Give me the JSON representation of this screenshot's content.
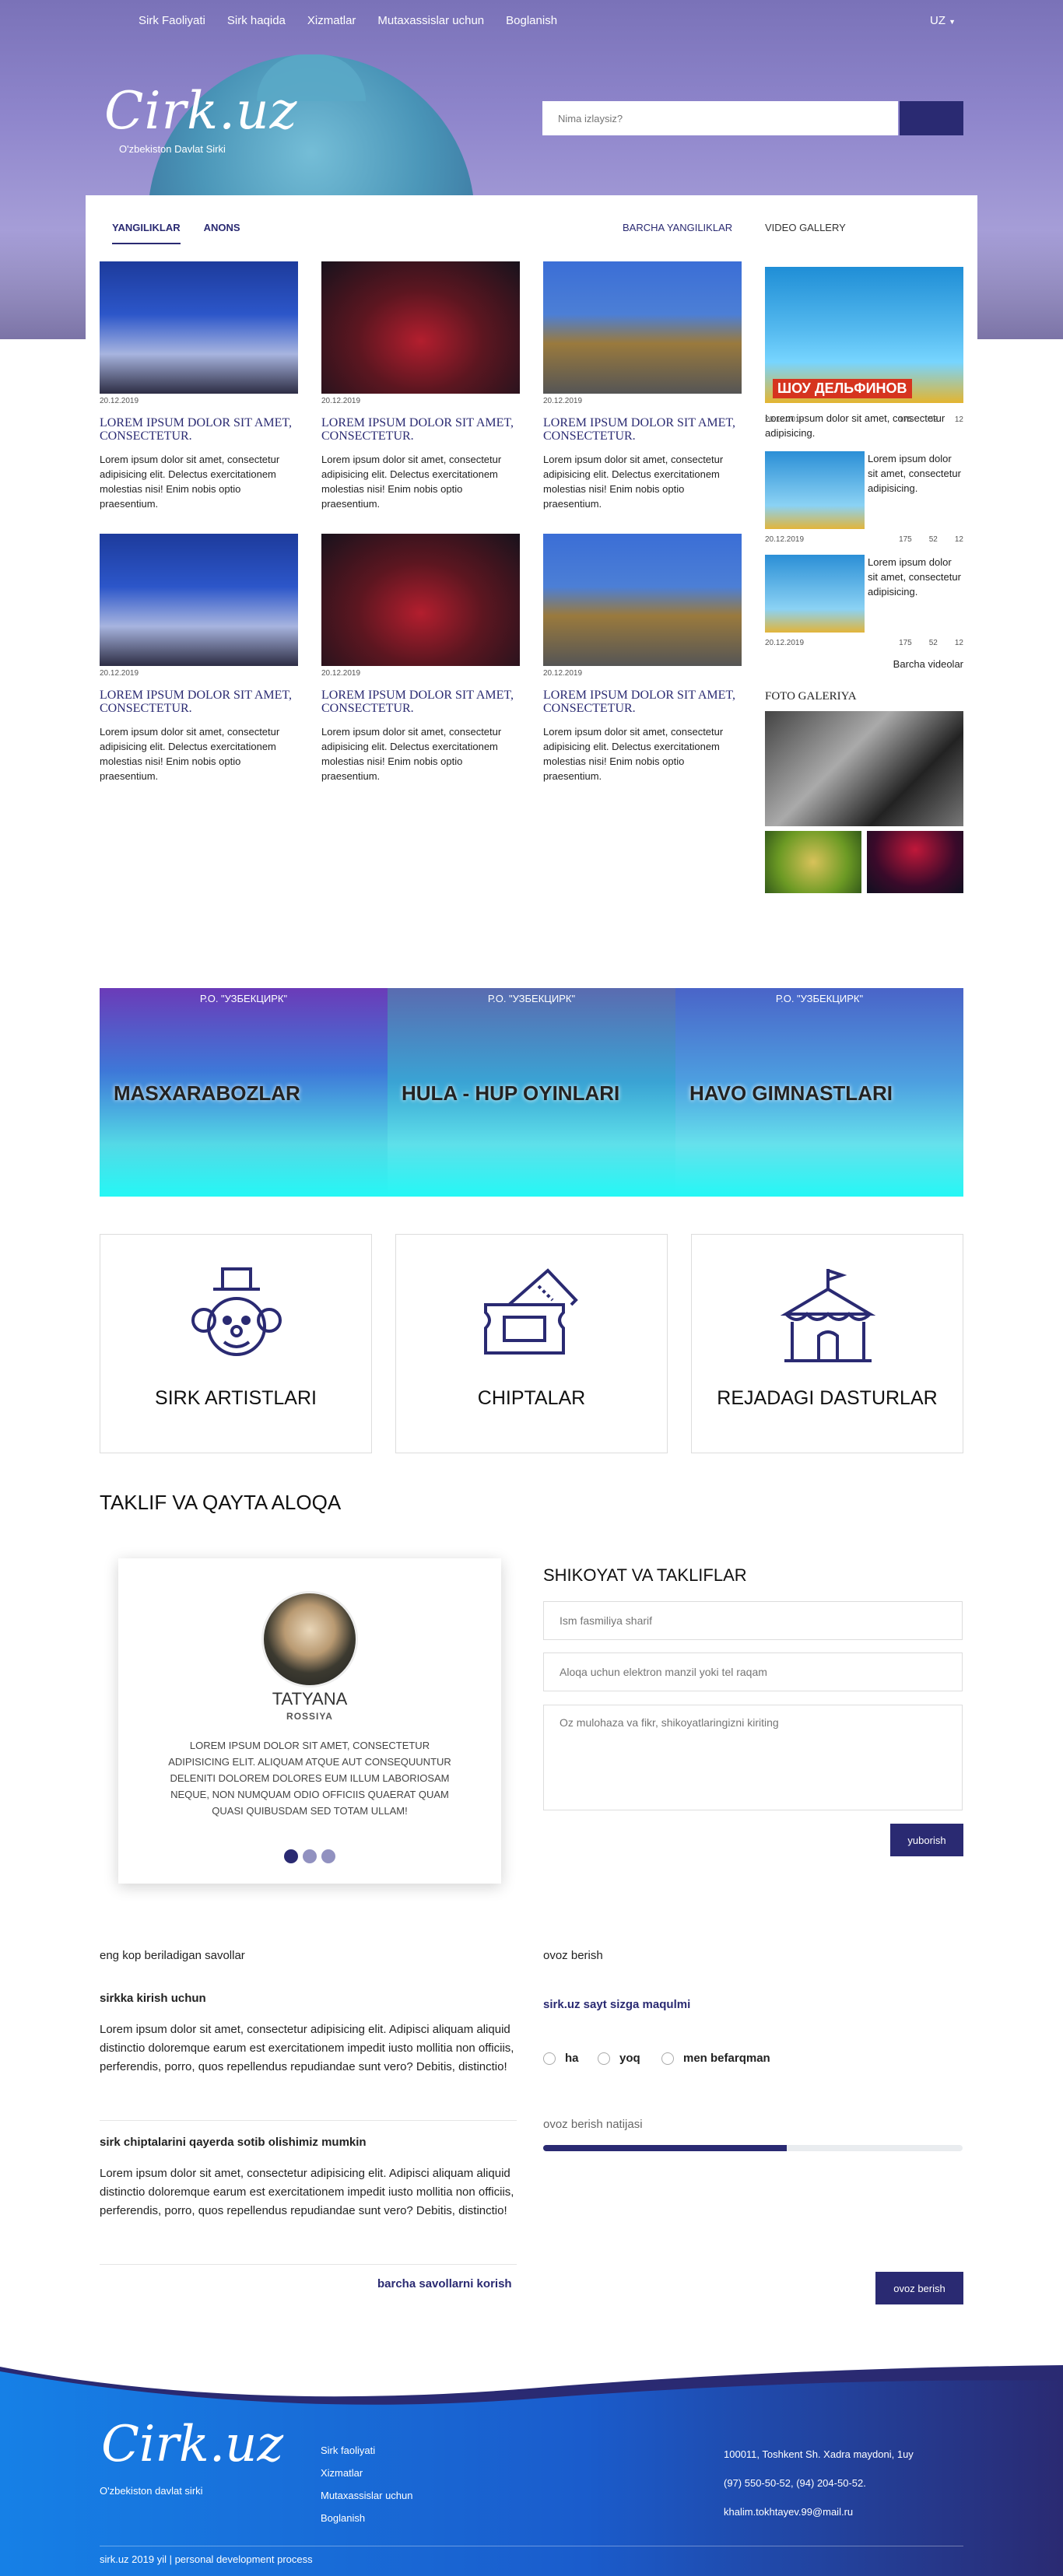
{
  "nav": {
    "items": [
      "Sirk Faoliyati",
      "Sirk haqida",
      "Xizmatlar",
      "Mutaxassislar uchun",
      "Boglanish"
    ],
    "lang": "UZ"
  },
  "hero": {
    "logo": "Cirk.uz",
    "subtitle": "O'zbekiston Davlat Sirki",
    "search_placeholder": "Nima izlaysiz?"
  },
  "news": {
    "tabs": [
      "YANGILIKLAR",
      "ANONS"
    ],
    "all_link": "BARCHA YANGILIKLAR",
    "items": [
      {
        "date": "20.12.2019",
        "title": "LOREM IPSUM DOLOR SIT AMET, CONSECTETUR.",
        "text": "Lorem ipsum dolor sit amet, consectetur adipisicing elit. Delectus exercitationem molestias nisi! Enim nobis optio praesentium."
      },
      {
        "date": "20.12.2019",
        "title": "LOREM IPSUM DOLOR SIT AMET, CONSECTETUR.",
        "text": "Lorem ipsum dolor sit amet, consectetur adipisicing elit. Delectus exercitationem molestias nisi! Enim nobis optio praesentium."
      },
      {
        "date": "20.12.2019",
        "title": "LOREM IPSUM DOLOR SIT AMET, CONSECTETUR.",
        "text": "Lorem ipsum dolor sit amet, consectetur adipisicing elit. Delectus exercitationem molestias nisi! Enim nobis optio praesentium."
      },
      {
        "date": "20.12.2019",
        "title": "LOREM IPSUM DOLOR SIT AMET, CONSECTETUR.",
        "text": "Lorem ipsum dolor sit amet, consectetur adipisicing elit. Delectus exercitationem molestias nisi! Enim nobis optio praesentium."
      },
      {
        "date": "20.12.2019",
        "title": "LOREM IPSUM DOLOR SIT AMET, CONSECTETUR.",
        "text": "Lorem ipsum dolor sit amet, consectetur adipisicing elit. Delectus exercitationem molestias nisi! Enim nobis optio praesentium."
      },
      {
        "date": "20.12.2019",
        "title": "LOREM IPSUM DOLOR SIT AMET, CONSECTETUR.",
        "text": "Lorem ipsum dolor sit amet, consectetur adipisicing elit. Delectus exercitationem molestias nisi! Enim nobis optio praesentium."
      }
    ]
  },
  "video": {
    "heading": "VIDEO GALLERY",
    "main_caption": "Lorem ipsum dolor sit amet, consectetur adipisicing.",
    "main_meta": {
      "date": "20.12.2019",
      "a": "175",
      "b": "52",
      "c": "12"
    },
    "thumbs": [
      {
        "caption": "Lorem ipsum dolor sit amet, consectetur adipisicing.",
        "date": "20.12.2019",
        "a": "175",
        "b": "52",
        "c": "12"
      },
      {
        "caption": "Lorem ipsum dolor sit amet, consectetur adipisicing.",
        "date": "20.12.2019",
        "a": "175",
        "b": "52",
        "c": "12"
      }
    ],
    "all_link": "Barcha videolar",
    "poster_text": "ШОУ ДЕЛЬФИНОВ"
  },
  "photo": {
    "heading": "FOTO GALERIYA"
  },
  "acts": [
    {
      "label": "MASXARABOZLAR",
      "org": "Р.О. \"УЗБЕКЦИРК\""
    },
    {
      "label": "HULA - HUP OYINLARI",
      "org": "Р.О. \"УЗБЕКЦИРК\""
    },
    {
      "label": "HAVO GIMNASTLARI",
      "org": "Р.О. \"УЗБЕКЦИРК\""
    }
  ],
  "services": [
    "SIRK ARTISTLARI",
    "CHIPTALAR",
    "REJADAGI DASTURLAR"
  ],
  "feedback": {
    "heading": "TAKLIF VA QAYTA ALOQA",
    "testimonial": {
      "name": "TATYANA",
      "country": "ROSSIYA",
      "text": "LOREM IPSUM DOLOR SIT AMET, CONSECTETUR ADIPISICING ELIT. ALIQUAM ATQUE AUT CONSEQUUNTUR DELENITI DOLOREM DOLORES EUM ILLUM LABORIOSAM NEQUE, NON NUMQUAM ODIO OFFICIIS QUAERAT QUAM QUASI QUIBUSDAM SED TOTAM ULLAM!"
    },
    "form": {
      "heading": "SHIKOYAT VA TAKLIFLAR",
      "name_placeholder": "Ism fasmiliya sharif",
      "contact_placeholder": "Aloqa uchun elektron manzil yoki tel raqam",
      "message_placeholder": "Oz mulohaza va fikr, shikoyatlaringizni kiriting",
      "submit": "yuborish"
    }
  },
  "faq": {
    "heading": "eng kop beriladigan savollar",
    "items": [
      {
        "q": "sirkka kirish uchun",
        "a": "Lorem ipsum dolor sit amet, consectetur adipisicing elit. Adipisci aliquam aliquid distinctio doloremque earum est exercitationem impedit iusto mollitia non officiis, perferendis, porro, quos repellendus repudiandae sunt vero? Debitis, distinctio!"
      },
      {
        "q": "sirk chiptalarini qayerda sotib olishimiz mumkin",
        "a": "Lorem ipsum dolor sit amet, consectetur adipisicing elit. Adipisci aliquam aliquid distinctio doloremque earum est exercitationem impedit iusto mollitia non officiis, perferendis, porro, quos repellendus repudiandae sunt vero? Debitis, distinctio!"
      }
    ],
    "all_link": "barcha savollarni korish"
  },
  "poll": {
    "heading": "ovoz berish",
    "question": "sirk.uz sayt sizga maqulmi",
    "options": [
      "ha",
      "yoq",
      "men befarqman"
    ],
    "result_label": "ovoz berish natijasi",
    "result_fraction": 0.58,
    "vote_button": "ovoz berish"
  },
  "footer": {
    "logo": "Cirk.uz",
    "subtitle": "O'zbekiston davlat sirki",
    "links": [
      "Sirk faoliyati",
      "Xizmatlar",
      "Mutaxassislar uchun",
      "Boglanish"
    ],
    "address": "100011, Toshkent Sh. Xadra maydoni, 1uy",
    "phone": "(97) 550-50-52, (94) 204-50-52.",
    "email": "khalim.tokhtayev.99@mail.ru",
    "copyright": "sirk.uz 2019 yil | personal development process"
  },
  "colors": {
    "primary": "#2a2a72",
    "footer_blue": "#1b78e0",
    "act_cyan": "#25f7f5"
  }
}
